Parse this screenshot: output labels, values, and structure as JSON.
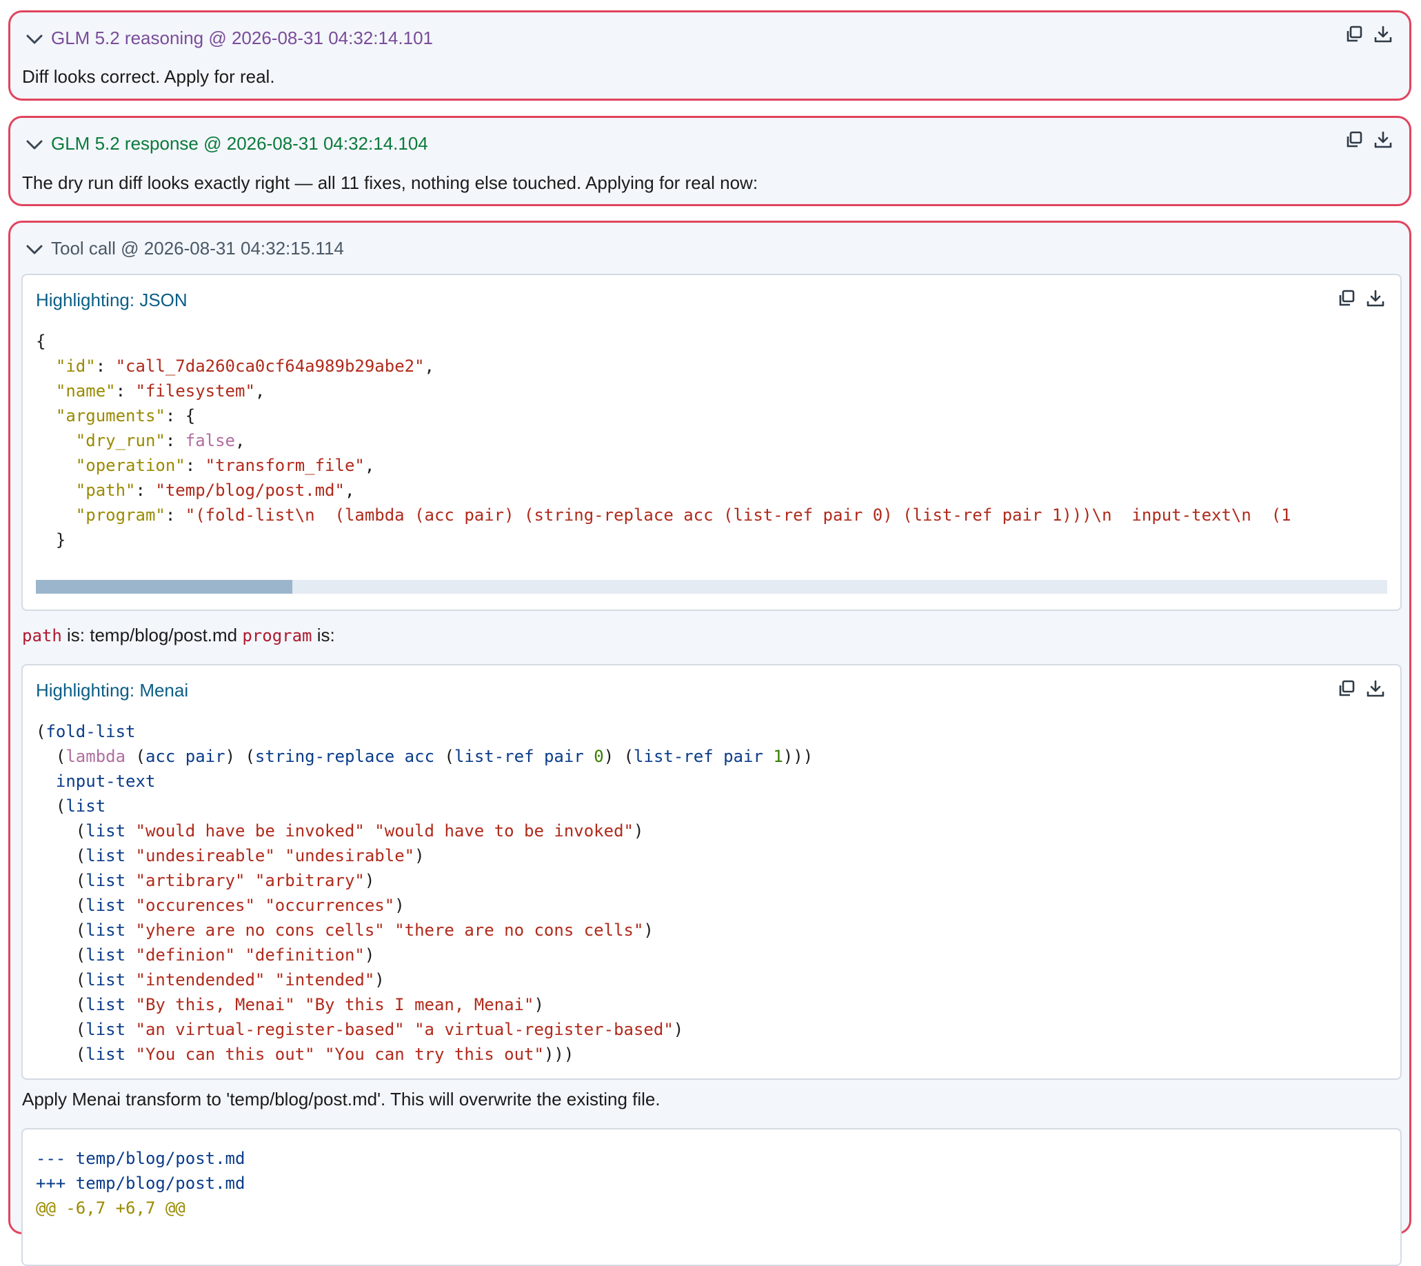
{
  "messages": {
    "reasoning": {
      "title": "GLM 5.2 reasoning @ 2026-08-31 04:32:14.101",
      "text": "Diff looks correct. Apply for real."
    },
    "response": {
      "title": "GLM 5.2 response @ 2026-08-31 04:32:14.104",
      "text": "The dry run diff looks exactly right — all 11 fixes, nothing else touched. Applying for real now:"
    },
    "tool_call": {
      "title": "Tool call @ 2026-08-31 04:32:15.114",
      "json_card": {
        "title": "Highlighting: JSON",
        "id_key": "\"id\"",
        "id_value": "\"call_7da260ca0cf64a989b29abe2\"",
        "name_key": "\"name\"",
        "name_value": "\"filesystem\"",
        "arguments_key": "\"arguments\"",
        "dry_run_key": "\"dry_run\"",
        "dry_run_value": "false",
        "operation_key": "\"operation\"",
        "operation_value": "\"transform_file\"",
        "path_key": "\"path\"",
        "path_value": "\"temp/blog/post.md\"",
        "program_key": "\"program\"",
        "program_value": "\"(fold-list\\n  (lambda (acc pair) (string-replace acc (list-ref pair 0) (list-ref pair 1)))\\n  input-text\\n  (1",
        "scroll_fraction": 0.19
      },
      "path_label": "path",
      "path_text": " is: temp/blog/post.md ",
      "program_label": "program",
      "program_text": " is:",
      "menai_card": {
        "title": "Highlighting: Menai",
        "fn_fold": "fold-list",
        "kw_lambda": "lambda",
        "args": "acc pair",
        "fn_replace": "string-replace",
        "acc": "acc",
        "fn_listref": "list-ref",
        "pair": "pair",
        "zero": "0",
        "one": "1",
        "input": "input-text",
        "fn_list": "list",
        "pairs": [
          [
            "\"would have be invoked\"",
            "\"would have to be invoked\""
          ],
          [
            "\"undesireable\"",
            "\"undesirable\""
          ],
          [
            "\"artibrary\"",
            "\"arbitrary\""
          ],
          [
            "\"occurences\"",
            "\"occurrences\""
          ],
          [
            "\"yhere are no cons cells\"",
            "\"there are no cons cells\""
          ],
          [
            "\"definion\"",
            "\"definition\""
          ],
          [
            "\"intendended\"",
            "\"intended\""
          ],
          [
            "\"By this, Menai\"",
            "\"By this I mean, Menai\""
          ],
          [
            "\"an virtual-register-based\"",
            "\"a virtual-register-based\""
          ],
          [
            "\"You can this out\"",
            "\"You can try this out\""
          ]
        ]
      },
      "apply_text": "Apply Menai transform to 'temp/blog/post.md'. This will overwrite the existing file.",
      "diff_card": {
        "line1": "--- temp/blog/post.md",
        "line2": "+++ temp/blog/post.md",
        "line3": "@@ -6,7 +6,7 @@"
      }
    }
  },
  "colors": {
    "border": "#e0445e",
    "reasoning_title": "#7a4c9a",
    "response_title": "#0a7a3c",
    "card_title": "#0b5e86"
  },
  "icons": [
    "chevron-down-icon",
    "copy-icon",
    "download-icon"
  ]
}
